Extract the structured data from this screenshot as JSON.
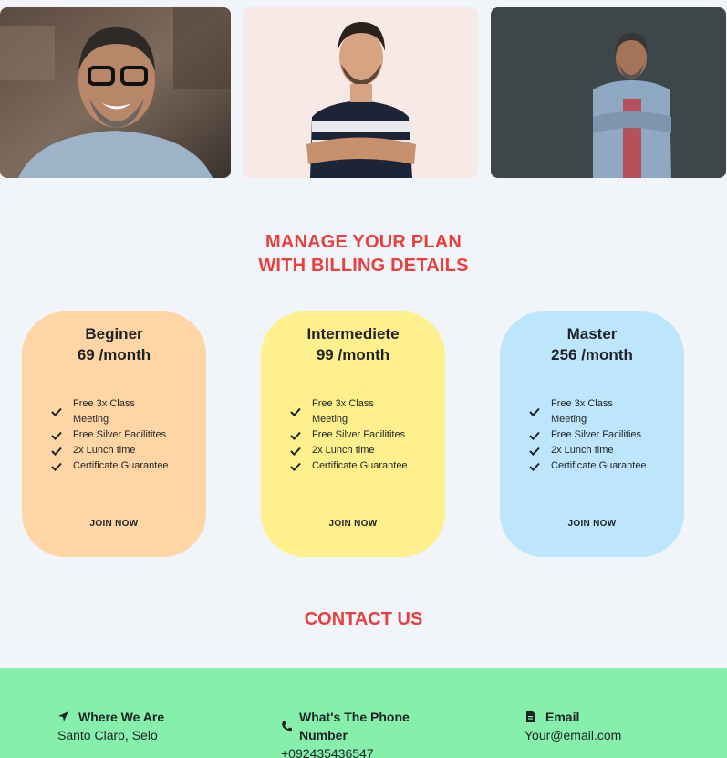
{
  "photos": [
    {
      "alt": "smiling man with glasses"
    },
    {
      "alt": "man in striped t-shirt with crossed arms"
    },
    {
      "alt": "man in denim shirt leaning on wall"
    }
  ],
  "plans": {
    "title_line1": "MANAGE YOUR PLAN",
    "title_line2": "WITH BILLING DETAILS",
    "cards": [
      {
        "name": "Beginer",
        "price": "69 /month",
        "color": "#fed6a6",
        "features": [
          "Free 3x Class Meeting",
          "Free Silver Facilitites",
          "2x Lunch time",
          "Certificate Guarantee"
        ],
        "cta": "JOIN NOW"
      },
      {
        "name": "Intermediete",
        "price": "99 /month",
        "color": "#fdf08d",
        "features": [
          "Free 3x Class Meeting",
          "Free Silver Facilitites",
          "2x Lunch time",
          "Certificate Guarantee"
        ],
        "cta": "JOIN NOW"
      },
      {
        "name": "Master",
        "price": "256 /month",
        "color": "#bde5fb",
        "features": [
          "Free 3x Class Meeting",
          "Free Silver Facilities",
          "2x Lunch time",
          "Certificate Guarantee"
        ],
        "cta": "JOIN NOW"
      }
    ]
  },
  "contact": {
    "title": "CONTACT US",
    "location": {
      "heading": "Where We Are",
      "value": "Santo Claro, Selo",
      "icon": "location-arrow-icon"
    },
    "phone": {
      "heading": "What's The Phone Number",
      "value": "+092435436547",
      "icon": "phone-icon"
    },
    "email": {
      "heading": "Email",
      "value": "Your@email.com",
      "icon": "file-icon"
    }
  },
  "colors": {
    "accent": "#e8403e",
    "footer": "#86efac",
    "background": "#f1f4f9"
  }
}
